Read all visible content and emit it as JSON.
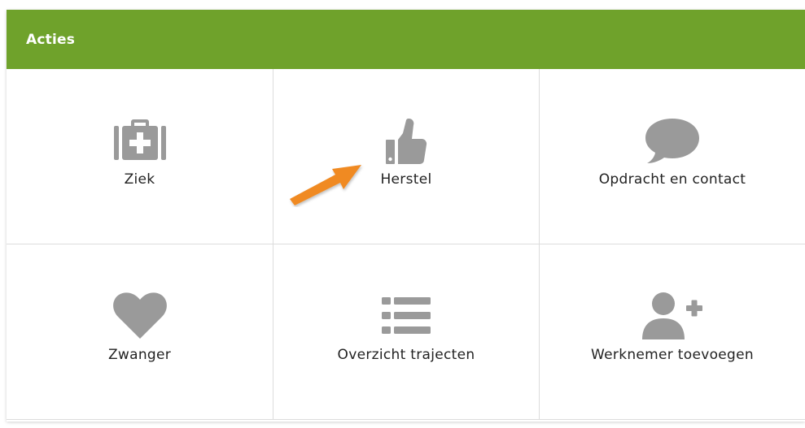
{
  "panel": {
    "title": "Acties",
    "header_color": "#6fa22b"
  },
  "tiles": [
    {
      "label": "Ziek",
      "icon": "medical-kit-icon"
    },
    {
      "label": "Herstel",
      "icon": "thumbs-up-icon"
    },
    {
      "label": "Opdracht en contact",
      "icon": "speech-bubble-icon"
    },
    {
      "label": "Zwanger",
      "icon": "heart-icon"
    },
    {
      "label": "Overzicht trajecten",
      "icon": "list-icon"
    },
    {
      "label": "Werknemer toevoegen",
      "icon": "add-user-icon"
    }
  ],
  "colors": {
    "icon": "#9a9a9a",
    "annotation_arrow": "#f08a24",
    "divider": "#dcdcdc"
  }
}
